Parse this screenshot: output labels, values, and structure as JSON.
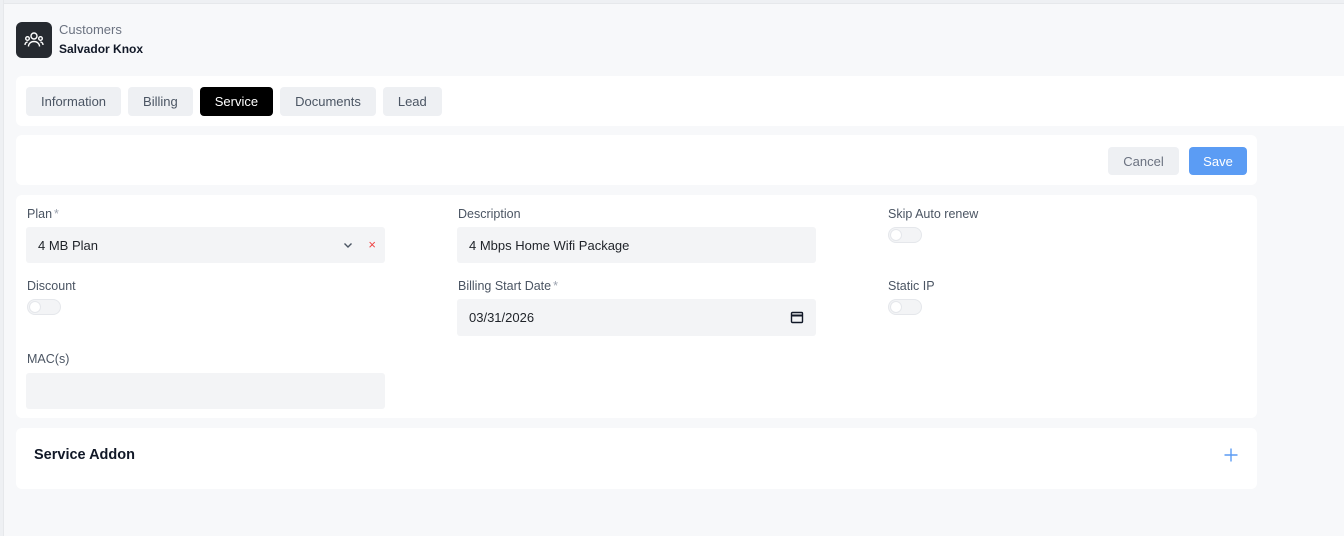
{
  "header": {
    "breadcrumb": "Customers",
    "customer_name": "Salvador Knox",
    "logo_icon": "users-icon"
  },
  "tabs": [
    {
      "label": "Information",
      "active": false
    },
    {
      "label": "Billing",
      "active": false
    },
    {
      "label": "Service",
      "active": true
    },
    {
      "label": "Documents",
      "active": false
    },
    {
      "label": "Lead",
      "active": false
    }
  ],
  "actions": {
    "cancel_label": "Cancel",
    "save_label": "Save"
  },
  "form": {
    "plan": {
      "label": "Plan",
      "required_mark": "*",
      "value": "4 MB Plan",
      "clear_glyph": "×"
    },
    "description": {
      "label": "Description",
      "value": "4 Mbps Home Wifi Package"
    },
    "skip_auto_renew": {
      "label": "Skip Auto renew",
      "enabled": false
    },
    "discount": {
      "label": "Discount",
      "enabled": false
    },
    "billing_start_date": {
      "label": "Billing Start Date",
      "required_mark": "*",
      "value": "03/31/2026"
    },
    "static_ip": {
      "label": "Static IP",
      "enabled": false
    },
    "macs": {
      "label": "MAC(s)",
      "value": ""
    }
  },
  "service_addon": {
    "title": "Service Addon"
  },
  "colors": {
    "accent": "#5b9cf4",
    "active_tab": "#000000",
    "clear_icon": "#ef4444"
  }
}
